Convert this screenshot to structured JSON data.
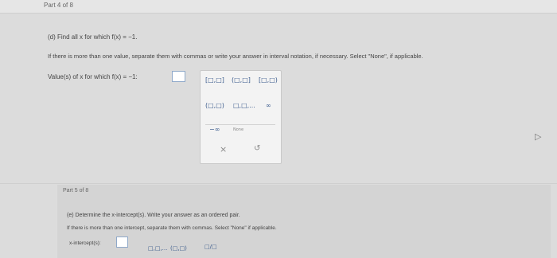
{
  "part4": {
    "label": "Part 4 of 8",
    "question": "(d) Find all x for which f(x) = −1.",
    "instructions": "If there is more than one value, separate them with commas or write your answer in interval notation, if necessary. Select \"None\", if applicable.",
    "answer_label": "Value(s) of x for which f(x) = −1:"
  },
  "palette": {
    "row1": [
      "[□,□]",
      "(□,□]",
      "[□,□)"
    ],
    "row2": [
      "(□,□)",
      "□,□,...",
      "∞"
    ],
    "row3": [
      "−∞",
      "None"
    ],
    "clear": "×",
    "undo": "↺"
  },
  "part5": {
    "label": "Part 5 of 8",
    "question": "(e) Determine the x-intercept(s). Write your answer as an ordered pair.",
    "instructions": "If there is more than one intercept, separate them with commas. Select \"None\" if applicable.",
    "answer_label": "x-intercept(s):",
    "buttons": [
      "□,□,...",
      "(□,□)",
      "□/□"
    ]
  }
}
